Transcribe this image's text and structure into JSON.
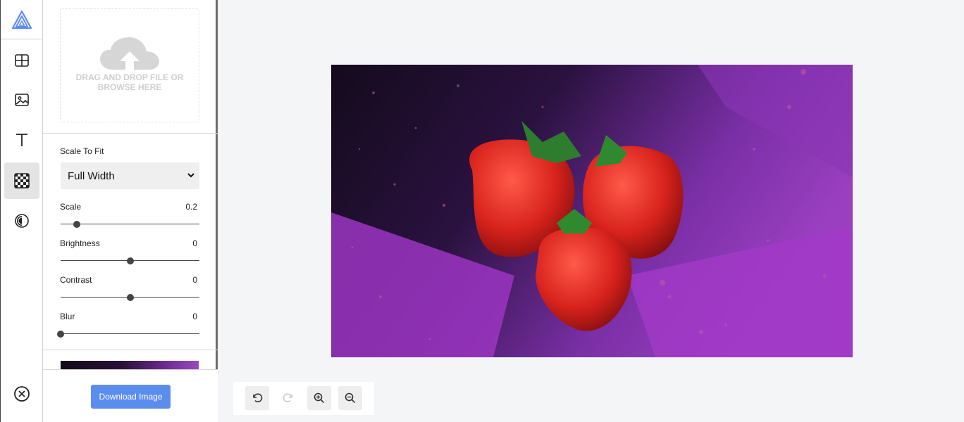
{
  "sidebar_rail": {
    "tools": [
      {
        "icon": "layout-grid-icon",
        "active": false
      },
      {
        "icon": "image-icon",
        "active": false
      },
      {
        "icon": "text-icon",
        "active": false
      },
      {
        "icon": "checkerboard-icon",
        "active": true
      },
      {
        "icon": "contrast-filter-icon",
        "active": false
      }
    ],
    "close_icon": "close-circle-icon"
  },
  "panel": {
    "dropzone": {
      "text": "Drag and drop file or browse here",
      "icon": "cloud-upload-icon"
    },
    "scale_to_fit": {
      "label": "Scale To Fit",
      "selected": "Full Width"
    },
    "sliders": [
      {
        "label": "Scale",
        "value": "0.2",
        "fraction": 0.116
      },
      {
        "label": "Brightness",
        "value": "0",
        "fraction": 0.5
      },
      {
        "label": "Contrast",
        "value": "0",
        "fraction": 0.5
      },
      {
        "label": "Blur",
        "value": "0",
        "fraction": 0.0
      }
    ],
    "download_label": "Download Image"
  },
  "toolbar": {
    "buttons": [
      {
        "icon": "undo-icon",
        "enabled": true
      },
      {
        "icon": "redo-icon",
        "enabled": false
      },
      {
        "icon": "zoom-in-icon",
        "enabled": true
      },
      {
        "icon": "zoom-out-icon",
        "enabled": true
      }
    ]
  },
  "colors": {
    "accent": "#5b8def",
    "logo": "#5b8def",
    "canvas_bg": "#f4f5f7"
  }
}
